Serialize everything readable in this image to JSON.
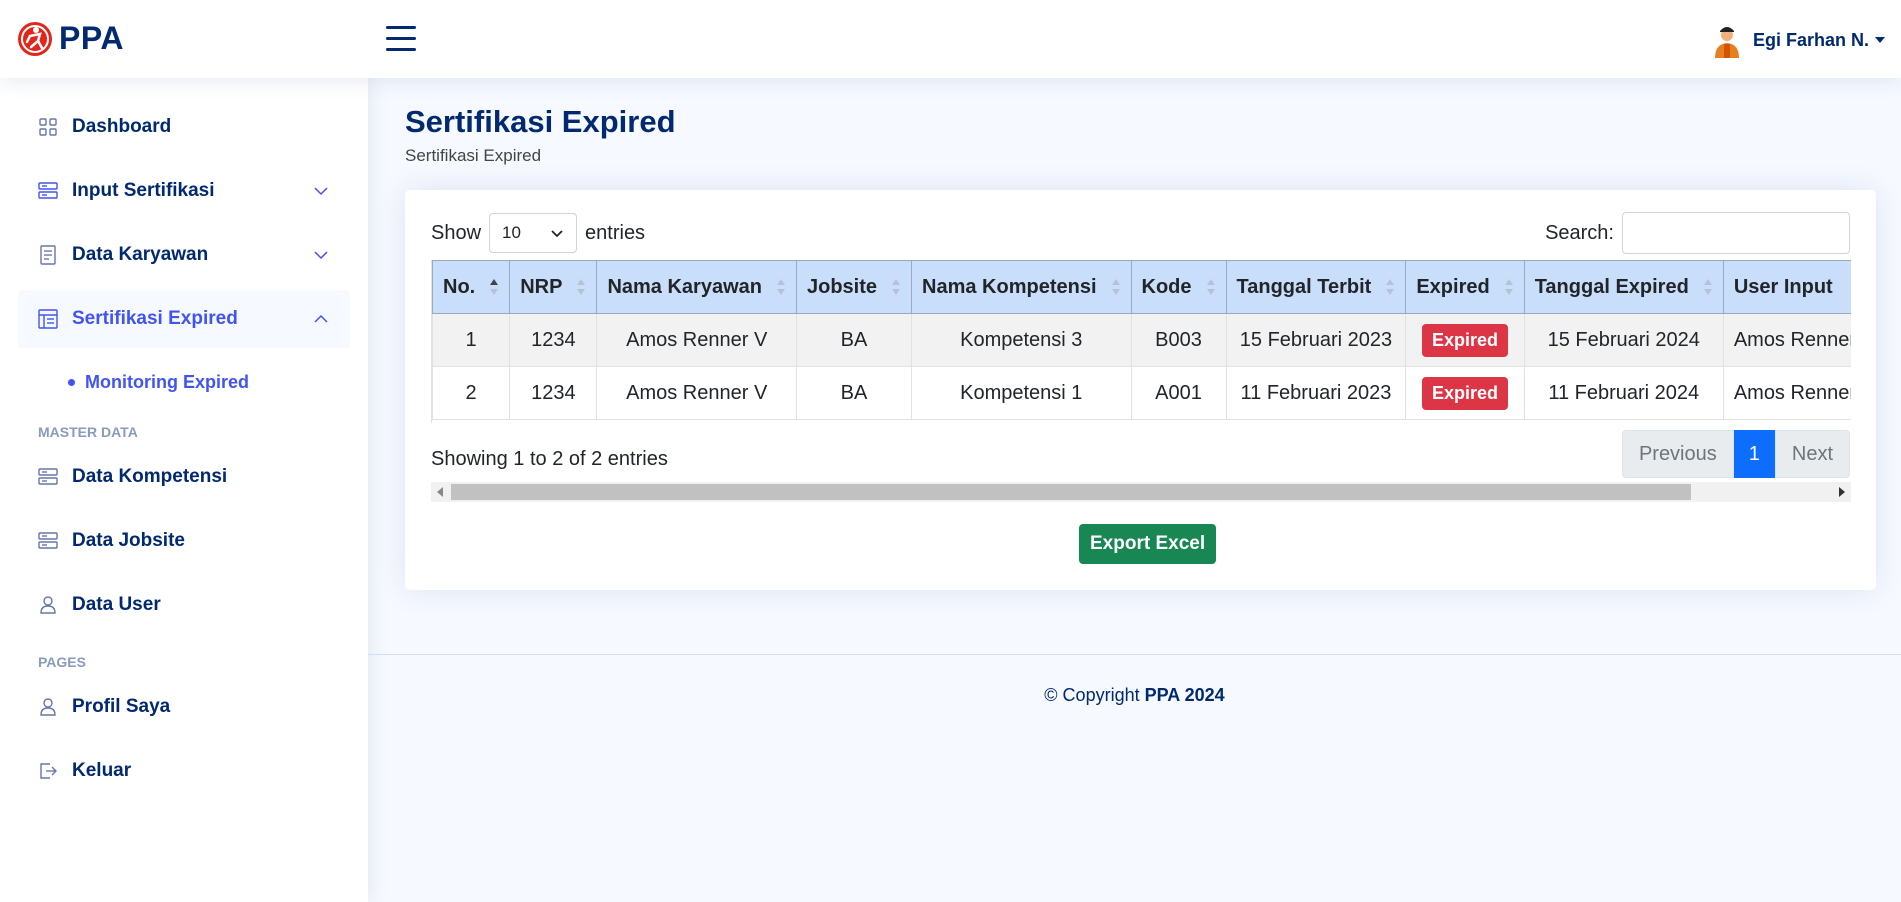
{
  "header": {
    "brand": "PPA",
    "user_name": "Egi Farhan N."
  },
  "sidebar": {
    "items": [
      {
        "label": "Dashboard",
        "icon": "grid-icon"
      },
      {
        "label": "Input Sertifikasi",
        "icon": "server-icon"
      },
      {
        "label": "Data Karyawan",
        "icon": "document-icon"
      },
      {
        "label": "Sertifikasi Expired",
        "icon": "layout-icon"
      }
    ],
    "sub_item": "Monitoring Expired",
    "section_master": "MASTER DATA",
    "master_items": [
      {
        "label": "Data Kompetensi",
        "icon": "server-icon"
      },
      {
        "label": "Data Jobsite",
        "icon": "server-icon"
      },
      {
        "label": "Data User",
        "icon": "person-icon"
      }
    ],
    "section_pages": "PAGES",
    "page_items": [
      {
        "label": "Profil Saya",
        "icon": "person-icon"
      },
      {
        "label": "Keluar",
        "icon": "logout-icon"
      }
    ]
  },
  "main": {
    "title": "Sertifikasi Expired",
    "breadcrumb": "Sertifikasi Expired",
    "show_label": "Show",
    "entries_value": "10",
    "entries_label": "entries",
    "search_label": "Search:",
    "search_value": "",
    "columns": [
      "No.",
      "NRP",
      "Nama Karyawan",
      "Jobsite",
      "Nama Kompetensi",
      "Kode",
      "Tanggal Terbit",
      "Expired",
      "Tanggal Expired",
      "User Input"
    ],
    "rows": [
      [
        "1",
        "1234",
        "Amos Renner V",
        "BA",
        "Kompetensi 3",
        "B003",
        "15 Februari 2023",
        "Expired",
        "15 Februari 2024",
        "Amos Renner V"
      ],
      [
        "2",
        "1234",
        "Amos Renner V",
        "BA",
        "Kompetensi 1",
        "A001",
        "11 Februari 2023",
        "Expired",
        "11 Februari 2024",
        "Amos Renner V"
      ]
    ],
    "info": "Showing 1 to 2 of 2 entries",
    "pager": {
      "prev": "Previous",
      "current": "1",
      "next": "Next"
    },
    "export_label": "Export Excel"
  },
  "footer": {
    "prefix": "© Copyright",
    "brand": "PPA 2024"
  },
  "colors": {
    "brand": "#012970",
    "accent": "#4154f1",
    "danger": "#dc3545",
    "success": "#198754",
    "primary": "#0d6efd"
  }
}
